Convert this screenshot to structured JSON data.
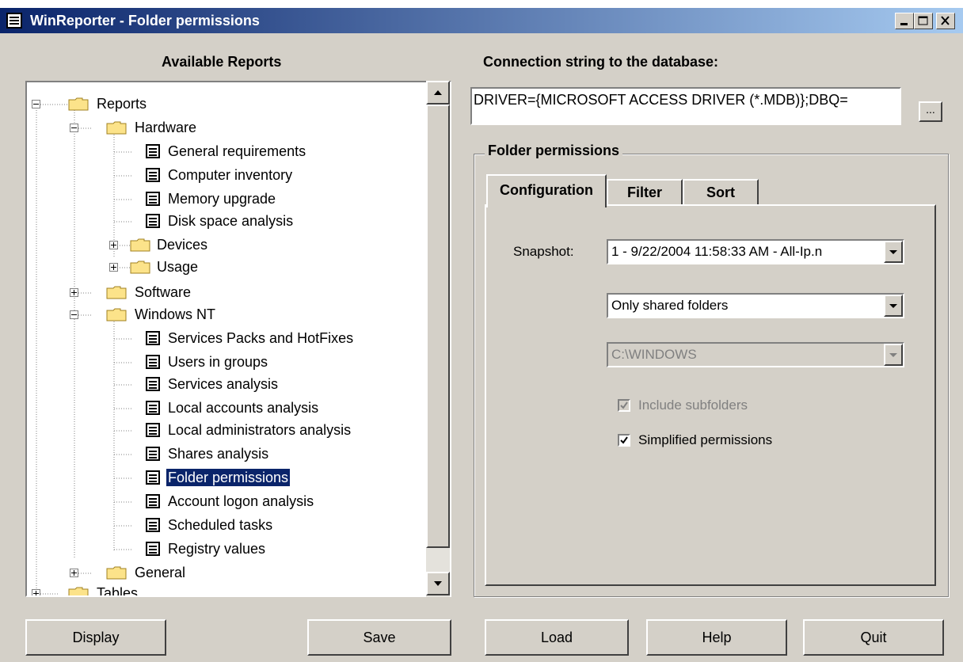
{
  "window": {
    "title": "WinReporter - Folder permissions"
  },
  "reports": {
    "label": "Available Reports",
    "tree": [
      {
        "label": "Reports"
      },
      {
        "label": "Hardware"
      },
      {
        "label": "General requirements"
      },
      {
        "label": "Computer inventory"
      },
      {
        "label": "Memory upgrade"
      },
      {
        "label": "Disk space analysis"
      },
      {
        "label": "Devices"
      },
      {
        "label": "Usage"
      },
      {
        "label": "Software"
      },
      {
        "label": "Windows NT"
      },
      {
        "label": "Services Packs and HotFixes"
      },
      {
        "label": "Users in groups"
      },
      {
        "label": "Services analysis"
      },
      {
        "label": "Local accounts analysis"
      },
      {
        "label": "Local administrators analysis"
      },
      {
        "label": "Shares analysis"
      },
      {
        "label": "Folder permissions"
      },
      {
        "label": "Account logon analysis"
      },
      {
        "label": "Scheduled tasks"
      },
      {
        "label": "Registry values"
      },
      {
        "label": "General"
      },
      {
        "label": "Tables"
      }
    ],
    "selected": "Folder permissions"
  },
  "connection": {
    "label": "Connection string to the database:",
    "value": "DRIVER={MICROSOFT ACCESS DRIVER (*.MDB)};DBQ=",
    "browse_label": "..."
  },
  "folder_permissions": {
    "group_title": "Folder permissions",
    "tabs": [
      {
        "label": "Configuration",
        "active": true
      },
      {
        "label": "Filter",
        "active": false
      },
      {
        "label": "Sort",
        "active": false
      }
    ],
    "snapshot_label": "Snapshot:",
    "snapshot_value": "1 - 9/22/2004 11:58:33 AM - All-Ip.n",
    "folder_filter_value": "Only shared folders",
    "folder_path_value": "C:\\WINDOWS",
    "include_subfolders": {
      "label": "Include subfolders",
      "checked": true,
      "enabled": false
    },
    "simplified_permissions": {
      "label": "Simplified permissions",
      "checked": true,
      "enabled": true
    }
  },
  "buttons": {
    "display": "Display",
    "save": "Save",
    "load": "Load",
    "help": "Help",
    "quit": "Quit"
  }
}
